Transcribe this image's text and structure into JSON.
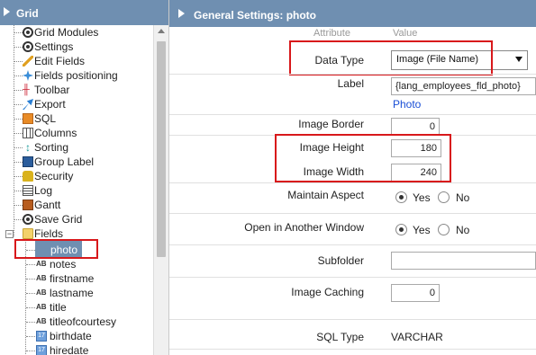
{
  "left_panel": {
    "title": "Grid",
    "tree": [
      {
        "label": "Grid Modules",
        "icon": "gear-icon"
      },
      {
        "label": "Settings",
        "icon": "gear-icon"
      },
      {
        "label": "Edit Fields",
        "icon": "pencil-icon"
      },
      {
        "label": "Fields positioning",
        "icon": "move-icon"
      },
      {
        "label": "Toolbar",
        "icon": "tools-icon"
      },
      {
        "label": "Export",
        "icon": "export-icon"
      },
      {
        "label": "SQL",
        "icon": "sql-icon"
      },
      {
        "label": "Columns",
        "icon": "columns-icon"
      },
      {
        "label": "Sorting",
        "icon": "sort-icon"
      },
      {
        "label": "Group Label",
        "icon": "group-icon"
      },
      {
        "label": "Security",
        "icon": "lock-icon"
      },
      {
        "label": "Log",
        "icon": "log-icon"
      },
      {
        "label": "Gantt",
        "icon": "gantt-icon"
      },
      {
        "label": "Save Grid",
        "icon": "gear-icon"
      },
      {
        "label": "Fields",
        "icon": "folder-icon"
      }
    ],
    "fields": [
      {
        "label": "photo",
        "icon": "image-icon",
        "selected": true
      },
      {
        "label": "notes",
        "icon": "ab-icon"
      },
      {
        "label": "firstname",
        "icon": "ab-icon"
      },
      {
        "label": "lastname",
        "icon": "ab-icon"
      },
      {
        "label": "title",
        "icon": "ab-icon"
      },
      {
        "label": "titleofcourtesy",
        "icon": "ab-icon"
      },
      {
        "label": "birthdate",
        "icon": "calendar-icon"
      },
      {
        "label": "hiredate",
        "icon": "calendar-icon"
      }
    ],
    "ab_glyph": "AB",
    "calendar_glyph": "17",
    "expander_glyph": "−"
  },
  "right_panel": {
    "title": "General Settings: photo",
    "col_attribute": "Attribute",
    "col_value": "Value",
    "data_type": {
      "label": "Data Type",
      "value": "Image (File Name)"
    },
    "label_field": {
      "label": "Label",
      "value": "{lang_employees_fld_photo}",
      "link": "Photo"
    },
    "image_border": {
      "label": "Image Border",
      "value": "0"
    },
    "image_height": {
      "label": "Image Height",
      "value": "180"
    },
    "image_width": {
      "label": "Image Width",
      "value": "240"
    },
    "maintain_aspect": {
      "label": "Maintain Aspect",
      "yes": "Yes",
      "no": "No",
      "selected": "Yes"
    },
    "open_window": {
      "label": "Open in Another Window",
      "yes": "Yes",
      "no": "No",
      "selected": "Yes"
    },
    "subfolder": {
      "label": "Subfolder",
      "value": ""
    },
    "image_caching": {
      "label": "Image Caching",
      "value": "0"
    },
    "sql_type": {
      "label": "SQL Type",
      "value": "VARCHAR"
    }
  },
  "colors": {
    "header": "#6f8fb1",
    "highlight": "#d8181b",
    "link": "#1a4fd6"
  }
}
